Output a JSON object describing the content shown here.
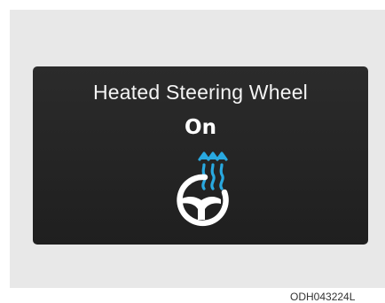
{
  "display": {
    "title": "Heated Steering Wheel",
    "status": "On"
  },
  "icon": {
    "name": "heated-steering-wheel-icon",
    "heat_color": "#29a9e0",
    "wheel_color": "#ffffff"
  },
  "figure_code": "ODH043224L"
}
